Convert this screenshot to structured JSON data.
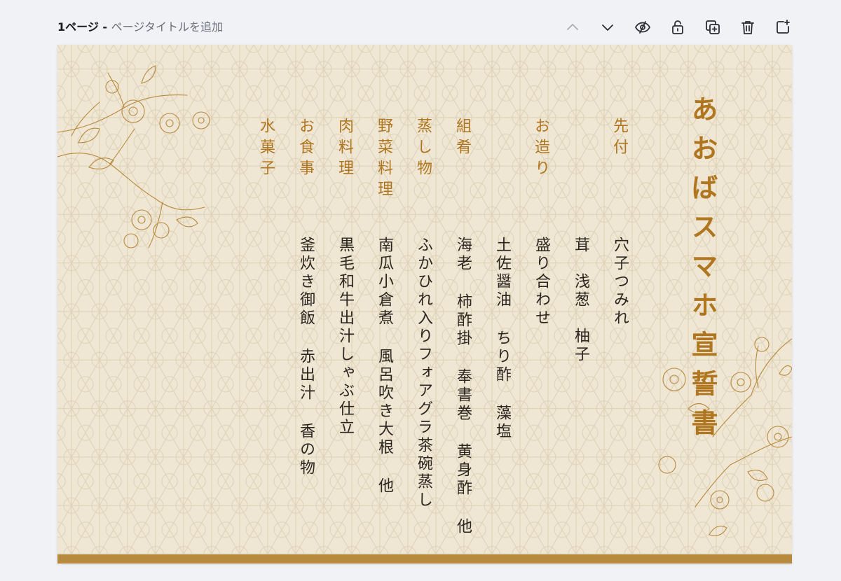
{
  "header": {
    "page_number": "1ページ",
    "separator": " - ",
    "add_title": "ページタイトルを追加"
  },
  "toolbar": {
    "icons": [
      "chevron-up-icon",
      "chevron-down-icon",
      "eye-icon",
      "lock-icon",
      "duplicate-icon",
      "trash-icon",
      "add-page-icon"
    ]
  },
  "menu": {
    "title": "あおばスマホ宣誓書",
    "courses": [
      {
        "label": "先付",
        "dish": "穴子つみれ"
      },
      {
        "label": "",
        "dish": "茸　浅葱　柚子"
      },
      {
        "label": "お造り",
        "dish": "盛り合わせ"
      },
      {
        "label": "",
        "dish": "土佐醤油 ちり酢 藻塩"
      },
      {
        "label": "組肴",
        "dish": "海老 柿酢掛 奉書巻 黄身酢 他"
      },
      {
        "label": "蒸し物",
        "dish": "ふかひれ入りフォアグラ茶碗蒸し"
      },
      {
        "label": "野菜料理",
        "dish": "南瓜小倉煮 風呂吹き大根 他"
      },
      {
        "label": "肉料理",
        "dish": "黒毛和牛出汁しゃぶ仕立"
      },
      {
        "label": "お食事",
        "dish": "釜炊き御飯 赤出汁 香の物"
      },
      {
        "label": "水菓子",
        "dish": ""
      }
    ]
  },
  "colors": {
    "accent": "#b0761f",
    "paper": "#efe6d3",
    "band": "#b88a3e",
    "ink": "#2c2520"
  }
}
